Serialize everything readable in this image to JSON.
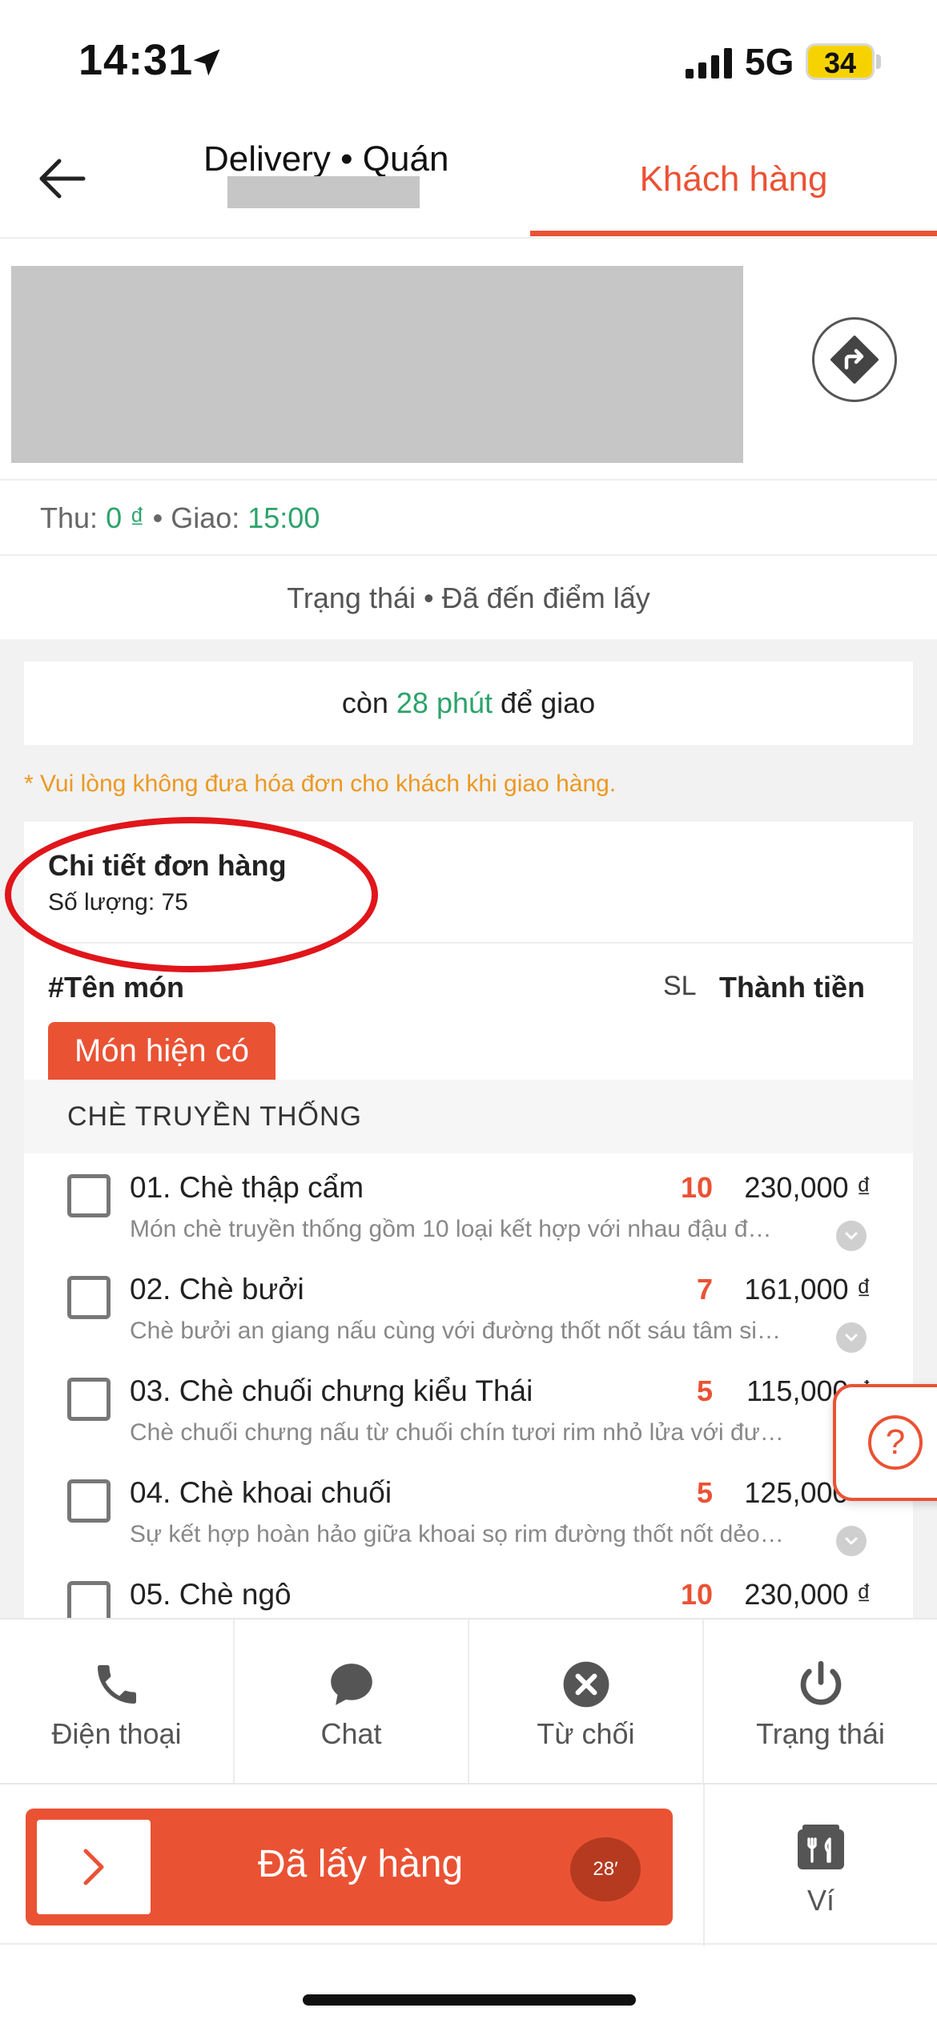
{
  "status_bar": {
    "time": "14:31",
    "network": "5G",
    "battery": "34"
  },
  "header": {
    "title": "Delivery • Quán",
    "customer_tab": "Khách hàng"
  },
  "collect": {
    "thu_label": "Thu:",
    "thu_value": "0 ₫",
    "sep": "•",
    "giao_label": "Giao:",
    "giao_value": "15:00"
  },
  "status_line": "Trạng thái • Đã đến điểm lấy",
  "remaining": {
    "prefix": "còn",
    "value": "28 phút",
    "suffix": "để giao"
  },
  "notice": "* Vui lòng không đưa hóa đơn cho khách khi giao hàng.",
  "order": {
    "title": "Chi tiết đơn hàng",
    "quantity": "Số lượng: 75",
    "col_name": "#Tên món",
    "col_qty": "SL",
    "col_total": "Thành tiền",
    "available_tag": "Món hiện có",
    "category": "CHÈ TRUYỀN THỐNG",
    "items": [
      {
        "name": "01. Chè thập cẩm",
        "qty": "10",
        "price": "230,000 ₫",
        "desc": "Món chè truyền thống gồm 10 loại kết hợp với nhau đậu đ…"
      },
      {
        "name": "02. Chè bưởi",
        "qty": "7",
        "price": "161,000 ₫",
        "desc": "Chè bưởi an giang nấu cùng với đường thốt nốt sáu tâm si…"
      },
      {
        "name": "03. Chè chuối chưng kiểu Thái",
        "qty": "5",
        "price": "115,000 ₫",
        "desc": "Chè chuối chưng nấu từ chuối chín tươi rim nhỏ lửa với đư…"
      },
      {
        "name": "04. Chè khoai chuối",
        "qty": "5",
        "price": "125,000 ₫",
        "desc": "Sự kết hợp hoàn hảo giữa khoai sọ rim đường thốt nốt dẻo…"
      },
      {
        "name": "05. Chè ngô",
        "qty": "10",
        "price": "230,000 ₫",
        "desc": ""
      }
    ]
  },
  "help_icon": "?",
  "actions": [
    {
      "label": "Điện thoại",
      "icon": "phone-icon"
    },
    {
      "label": "Chat",
      "icon": "chat-icon"
    },
    {
      "label": "Từ chối",
      "icon": "reject-icon"
    },
    {
      "label": "Trạng thái",
      "icon": "power-icon"
    }
  ],
  "main_button": {
    "label": "Đã lấy hàng",
    "timer": "28′"
  },
  "wallet": {
    "label": "Ví",
    "icon": "wallet-icon"
  },
  "colors": {
    "accent": "#ea5234",
    "green": "#2ca36b",
    "notice": "#ec9822",
    "annotation": "#e0161b"
  }
}
